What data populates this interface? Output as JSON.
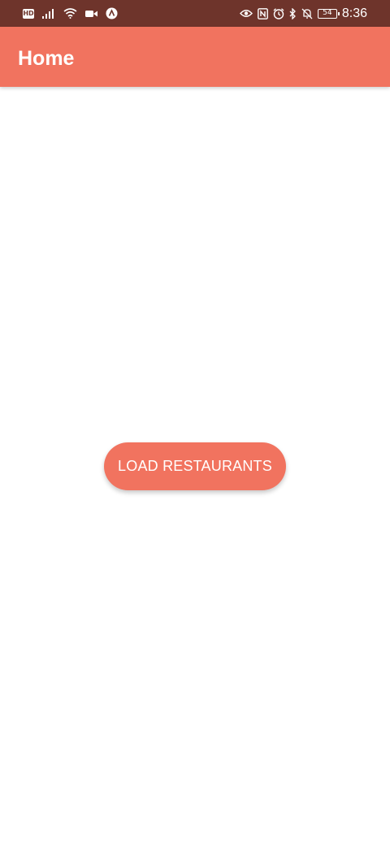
{
  "status_bar": {
    "background": "#6e342b",
    "hd_label": "HD",
    "battery_level": "54",
    "time": "8:36",
    "left_icons": [
      "hd-icon",
      "signal-icon",
      "wifi-icon",
      "video-camera-icon",
      "notification-app-icon"
    ],
    "right_icons": [
      "eye-icon",
      "nfc-icon",
      "alarm-icon",
      "bluetooth-icon",
      "mute-bell-icon",
      "battery-icon"
    ]
  },
  "app_bar": {
    "title": "Home",
    "background": "#f1735f"
  },
  "main": {
    "load_button_label": "LOAD RESTAURANTS",
    "accent": "#f1735f"
  }
}
